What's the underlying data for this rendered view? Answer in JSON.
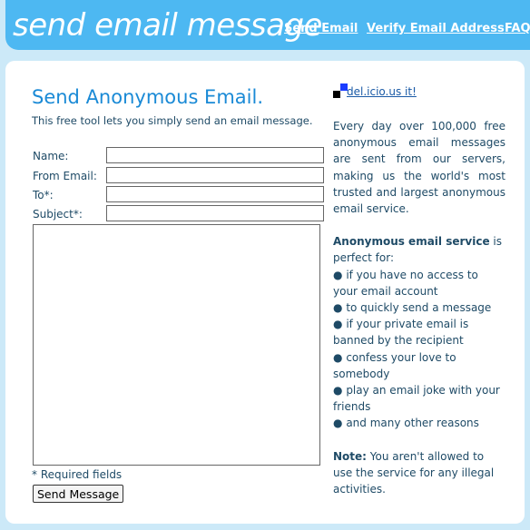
{
  "header": {
    "logo_text": "send email message",
    "nav": [
      {
        "label": "Send Email"
      },
      {
        "label": "Verify Email Address"
      },
      {
        "label": "FAQ"
      }
    ]
  },
  "form": {
    "title": "Send Anonymous Email.",
    "description": "This free tool lets you simply send an email message.",
    "fields": [
      {
        "label": "Name:",
        "value": ""
      },
      {
        "label": "From Email:",
        "value": ""
      },
      {
        "label": "To*:",
        "value": ""
      },
      {
        "label": "Subject*:",
        "value": ""
      }
    ],
    "message_value": "",
    "required_note": "* Required fields",
    "send_label": "Send Message"
  },
  "sidebar": {
    "delicious_label": "del.icio.us it!",
    "intro": "Every day over 100,000 free anonymous email messages are sent from our servers, making us the world's most trusted and largest anonymous email service.",
    "service_heading": "Anonymous email service",
    "service_suffix": " is perfect for:",
    "bullets": [
      "if you have no access to your email account",
      "to quickly send a message",
      "if your private email is banned by the recipient",
      "confess your love to somebody",
      "play an email joke with your friends",
      "and many other reasons"
    ],
    "bullet_glyph": "●",
    "note_label": "Note:",
    "note_text": " You aren't allowed to use the service for any illegal activities."
  },
  "colors": {
    "header_bg": "#4db8f2",
    "page_bg": "#cce9f8",
    "title_blue": "#1a8ad6",
    "text": "#1e4a66",
    "delicious_blue": "#1a3cff",
    "delicious_black": "#000000"
  }
}
